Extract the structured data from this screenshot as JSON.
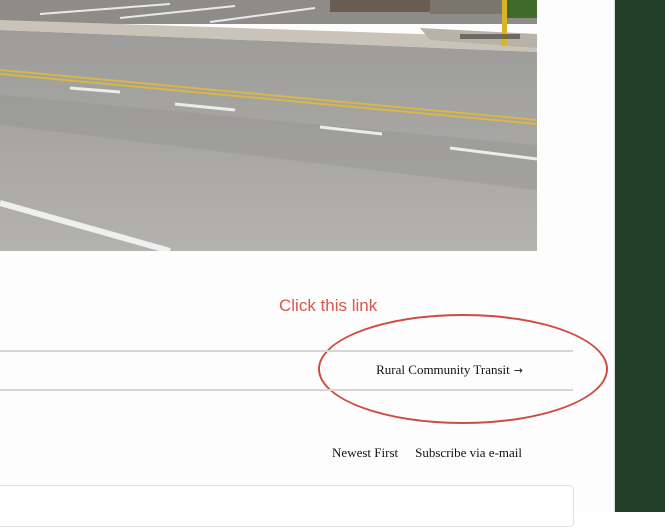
{
  "annotation": {
    "text": "Click this link"
  },
  "post_nav": {
    "next_label": "Rural Community Transit",
    "next_arrow": "→"
  },
  "comments": {
    "sort_label": "Newest First",
    "subscribe_label": "Subscribe via e-mail"
  },
  "colors": {
    "annotation": "#d9574a",
    "sidebar": "#203f26",
    "rule": "#d6d6d6"
  }
}
